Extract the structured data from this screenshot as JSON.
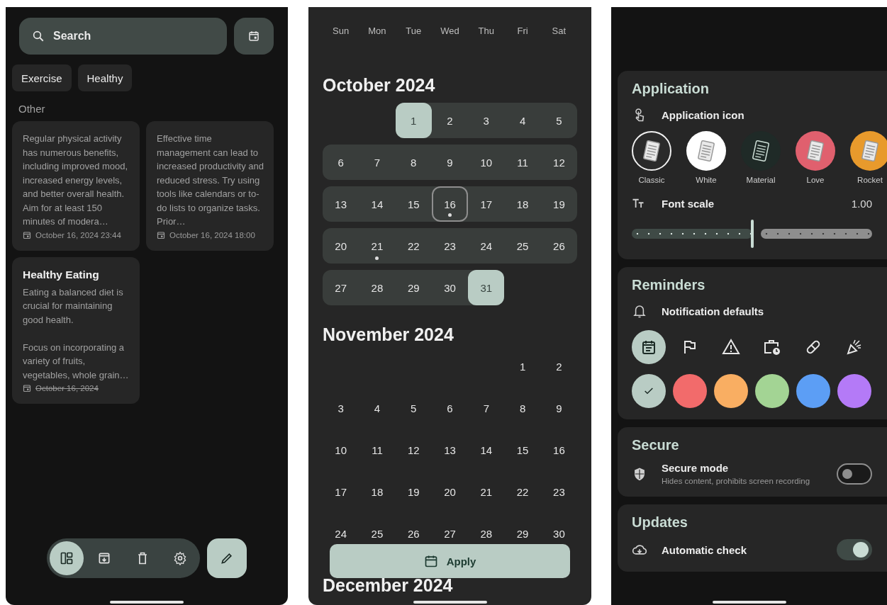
{
  "notes_screen": {
    "search": {
      "placeholder": "Search"
    },
    "tags": [
      {
        "label": "Exercise"
      },
      {
        "label": "Healthy"
      }
    ],
    "section": "Other",
    "notes": [
      {
        "body": "Regular physical activity has numerous benefits, including improved mood, increased energy levels, and better overall health. Aim for at least 150 minutes of modera…",
        "date": "October 16, 2024 23:44",
        "struck": false
      },
      {
        "body": "Effective time management can lead to increased productivity and reduced stress. Try using tools like calendars or to-do lists to organize tasks. Prior…",
        "date": "October 16, 2024 18:00",
        "struck": false
      },
      {
        "title": "Healthy Eating",
        "body": "Eating a balanced diet is crucial for maintaining good health.\n\nFocus on incorporating a variety of fruits, vegetables, whole grain…",
        "date": "October 16, 2024",
        "struck": true
      }
    ],
    "nav": [
      {
        "kind": "layout",
        "selected": true
      },
      {
        "kind": "archive",
        "selected": false
      },
      {
        "kind": "trash",
        "selected": false
      },
      {
        "kind": "settings",
        "selected": false
      }
    ]
  },
  "calendar_screen": {
    "weekdays": [
      "Sun",
      "Mon",
      "Tue",
      "Wed",
      "Thu",
      "Fri",
      "Sat"
    ],
    "months": [
      {
        "title": "October 2024",
        "in_range": true,
        "weeks": [
          {
            "days": [
              {
                "label": "1",
                "selected": true,
                "today": false,
                "event": false
              },
              {
                "label": "2",
                "selected": false,
                "today": false,
                "event": false
              },
              {
                "label": "3",
                "selected": false,
                "today": false,
                "event": false
              },
              {
                "label": "4",
                "selected": false,
                "today": false,
                "event": false
              },
              {
                "label": "5",
                "selected": false,
                "today": false,
                "event": false
              }
            ]
          },
          {
            "days": [
              {
                "label": "6",
                "selected": false,
                "today": false,
                "event": false
              },
              {
                "label": "7",
                "selected": false,
                "today": false,
                "event": false
              },
              {
                "label": "8",
                "selected": false,
                "today": false,
                "event": false
              },
              {
                "label": "9",
                "selected": false,
                "today": false,
                "event": false
              },
              {
                "label": "10",
                "selected": false,
                "today": false,
                "event": false
              },
              {
                "label": "11",
                "selected": false,
                "today": false,
                "event": false
              },
              {
                "label": "12",
                "selected": false,
                "today": false,
                "event": false
              }
            ]
          },
          {
            "days": [
              {
                "label": "13",
                "selected": false,
                "today": false,
                "event": false
              },
              {
                "label": "14",
                "selected": false,
                "today": false,
                "event": false
              },
              {
                "label": "15",
                "selected": false,
                "today": false,
                "event": false
              },
              {
                "label": "16",
                "selected": false,
                "today": true,
                "event": true
              },
              {
                "label": "17",
                "selected": false,
                "today": false,
                "event": false
              },
              {
                "label": "18",
                "selected": false,
                "today": false,
                "event": false
              },
              {
                "label": "19",
                "selected": false,
                "today": false,
                "event": false
              }
            ]
          },
          {
            "days": [
              {
                "label": "20",
                "selected": false,
                "today": false,
                "event": false
              },
              {
                "label": "21",
                "selected": false,
                "today": false,
                "event": true
              },
              {
                "label": "22",
                "selected": false,
                "today": false,
                "event": false
              },
              {
                "label": "23",
                "selected": false,
                "today": false,
                "event": false
              },
              {
                "label": "24",
                "selected": false,
                "today": false,
                "event": false
              },
              {
                "label": "25",
                "selected": false,
                "today": false,
                "event": false
              },
              {
                "label": "26",
                "selected": false,
                "today": false,
                "event": false
              }
            ]
          },
          {
            "days": [
              {
                "label": "27",
                "selected": false,
                "today": false,
                "event": false
              },
              {
                "label": "28",
                "selected": false,
                "today": false,
                "event": false
              },
              {
                "label": "29",
                "selected": false,
                "today": false,
                "event": false
              },
              {
                "label": "30",
                "selected": false,
                "today": false,
                "event": false
              },
              {
                "label": "31",
                "selected": true,
                "today": false,
                "event": false
              }
            ]
          }
        ]
      },
      {
        "title": "November 2024",
        "in_range": false,
        "weeks": [
          {
            "days": [
              {
                "label": "1",
                "selected": false,
                "today": false,
                "event": false
              },
              {
                "label": "2",
                "selected": false,
                "today": false,
                "event": false
              }
            ]
          },
          {
            "days": [
              {
                "label": "3",
                "selected": false,
                "today": false,
                "event": false
              },
              {
                "label": "4",
                "selected": false,
                "today": false,
                "event": false
              },
              {
                "label": "5",
                "selected": false,
                "today": false,
                "event": false
              },
              {
                "label": "6",
                "selected": false,
                "today": false,
                "event": false
              },
              {
                "label": "7",
                "selected": false,
                "today": false,
                "event": false
              },
              {
                "label": "8",
                "selected": false,
                "today": false,
                "event": false
              },
              {
                "label": "9",
                "selected": false,
                "today": false,
                "event": false
              }
            ]
          },
          {
            "days": [
              {
                "label": "10",
                "selected": false,
                "today": false,
                "event": false
              },
              {
                "label": "11",
                "selected": false,
                "today": false,
                "event": false
              },
              {
                "label": "12",
                "selected": false,
                "today": false,
                "event": false
              },
              {
                "label": "13",
                "selected": false,
                "today": false,
                "event": false
              },
              {
                "label": "14",
                "selected": false,
                "today": false,
                "event": false
              },
              {
                "label": "15",
                "selected": false,
                "today": false,
                "event": false
              },
              {
                "label": "16",
                "selected": false,
                "today": false,
                "event": false
              }
            ]
          },
          {
            "days": [
              {
                "label": "17",
                "selected": false,
                "today": false,
                "event": false
              },
              {
                "label": "18",
                "selected": false,
                "today": false,
                "event": false
              },
              {
                "label": "19",
                "selected": false,
                "today": false,
                "event": false
              },
              {
                "label": "20",
                "selected": false,
                "today": false,
                "event": false
              },
              {
                "label": "21",
                "selected": false,
                "today": false,
                "event": false
              },
              {
                "label": "22",
                "selected": false,
                "today": false,
                "event": false
              },
              {
                "label": "23",
                "selected": false,
                "today": false,
                "event": false
              }
            ]
          },
          {
            "days": [
              {
                "label": "24",
                "selected": false,
                "today": false,
                "event": false
              },
              {
                "label": "25",
                "selected": false,
                "today": false,
                "event": false
              },
              {
                "label": "26",
                "selected": false,
                "today": false,
                "event": false
              },
              {
                "label": "27",
                "selected": false,
                "today": false,
                "event": false
              },
              {
                "label": "28",
                "selected": false,
                "today": false,
                "event": false
              },
              {
                "label": "29",
                "selected": false,
                "today": false,
                "event": false
              },
              {
                "label": "30",
                "selected": false,
                "today": false,
                "event": false
              }
            ]
          }
        ]
      },
      {
        "title": "December 2024"
      }
    ],
    "apply_button": "Apply"
  },
  "settings_screen": {
    "sections": [
      {
        "title": "Application",
        "rows": [
          {
            "kind": "iconpicker",
            "label": "Application icon",
            "options": [
              {
                "label": "Classic",
                "color": "#2a2a2a",
                "selected": true
              },
              {
                "label": "White",
                "color": "#ffffff",
                "selected": false
              },
              {
                "label": "Material",
                "color": "#1f2a27",
                "selected": false
              },
              {
                "label": "Love",
                "color": "#e0606e",
                "selected": false
              },
              {
                "label": "Rocket",
                "color": "#e89a2c",
                "selected": false
              }
            ]
          },
          {
            "kind": "slider",
            "label": "Font scale",
            "reading": "1.00",
            "level": 0.5
          }
        ]
      },
      {
        "title": "Reminders",
        "rows": [
          {
            "kind": "notification",
            "label": "Notification defaults",
            "icons": [
              {
                "kind": "calendar",
                "selected": true
              },
              {
                "kind": "flag",
                "selected": false
              },
              {
                "kind": "warning",
                "selected": false
              },
              {
                "kind": "briefcase",
                "selected": false
              },
              {
                "kind": "pill",
                "selected": false
              },
              {
                "kind": "party",
                "selected": false
              }
            ],
            "colors": [
              {
                "color": "#b9ccc4",
                "selected": true
              },
              {
                "color": "#f26b6b",
                "selected": false
              },
              {
                "color": "#f9ae62",
                "selected": false
              },
              {
                "color": "#a3d494",
                "selected": false
              },
              {
                "color": "#5c9ef5",
                "selected": false
              },
              {
                "color": "#b47af7",
                "selected": false
              }
            ]
          }
        ]
      },
      {
        "title": "Secure",
        "rows": [
          {
            "kind": "switch",
            "label": "Secure mode",
            "subtitle": "Hides content, prohibits screen recording",
            "on": false
          }
        ]
      },
      {
        "title": "Updates",
        "rows": [
          {
            "kind": "switch",
            "label": "Automatic check",
            "on": true
          }
        ]
      }
    ]
  }
}
